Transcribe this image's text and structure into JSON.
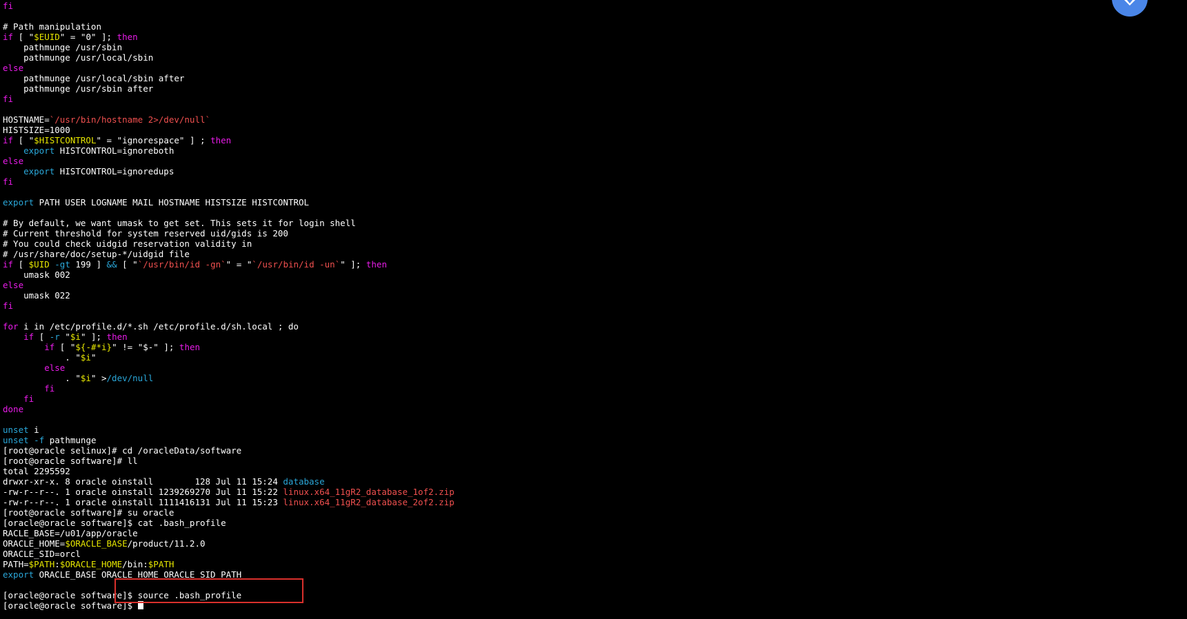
{
  "terminal": {
    "colors": {
      "background": "#000000",
      "foreground": "#ffffff",
      "keyword": "#e81ce8",
      "builtin": "#2aa7d9",
      "string": "#e6e600",
      "command_substitution": "#f0504f",
      "directory": "#2aa7d9",
      "archive": "#f0504f",
      "highlight_box": "#d9302c",
      "widget": "#4a86e8"
    },
    "cursor": "block",
    "lines": [
      [
        {
          "t": "fi",
          "c": "keyword"
        }
      ],
      [],
      [
        {
          "t": "# Path manipulation"
        }
      ],
      [
        {
          "t": "if",
          "c": "keyword"
        },
        {
          "t": " [ \""
        },
        {
          "t": "$EUID",
          "c": "string"
        },
        {
          "t": "\" = \"0\" ]; "
        },
        {
          "t": "then",
          "c": "keyword"
        }
      ],
      [
        {
          "t": "    pathmunge /usr/sbin"
        }
      ],
      [
        {
          "t": "    pathmunge /usr/local/sbin"
        }
      ],
      [
        {
          "t": "else",
          "c": "keyword"
        }
      ],
      [
        {
          "t": "    pathmunge /usr/local/sbin after"
        }
      ],
      [
        {
          "t": "    pathmunge /usr/sbin after"
        }
      ],
      [
        {
          "t": "fi",
          "c": "keyword"
        }
      ],
      [],
      [
        {
          "t": "HOSTNAME="
        },
        {
          "t": "`/usr/bin/hostname 2>/dev/null`",
          "c": "command_substitution"
        }
      ],
      [
        {
          "t": "HISTSIZE=1000"
        }
      ],
      [
        {
          "t": "if",
          "c": "keyword"
        },
        {
          "t": " [ \""
        },
        {
          "t": "$HISTCONTROL",
          "c": "string"
        },
        {
          "t": "\" = \"ignorespace\" ] ; "
        },
        {
          "t": "then",
          "c": "keyword"
        }
      ],
      [
        {
          "t": "    "
        },
        {
          "t": "export",
          "c": "builtin"
        },
        {
          "t": " HISTCONTROL=ignoreboth"
        }
      ],
      [
        {
          "t": "else",
          "c": "keyword"
        }
      ],
      [
        {
          "t": "    "
        },
        {
          "t": "export",
          "c": "builtin"
        },
        {
          "t": " HISTCONTROL=ignoredups"
        }
      ],
      [
        {
          "t": "fi",
          "c": "keyword"
        }
      ],
      [],
      [
        {
          "t": "export",
          "c": "builtin"
        },
        {
          "t": " PATH USER LOGNAME MAIL HOSTNAME HISTSIZE HISTCONTROL"
        }
      ],
      [],
      [
        {
          "t": "# By default, we want umask to get set. This sets it for login shell"
        }
      ],
      [
        {
          "t": "# Current threshold for system reserved uid/gids is 200"
        }
      ],
      [
        {
          "t": "# You could check uidgid reservation validity in"
        }
      ],
      [
        {
          "t": "# /usr/share/doc/setup-*/uidgid file"
        }
      ],
      [
        {
          "t": "if",
          "c": "keyword"
        },
        {
          "t": " [ "
        },
        {
          "t": "$UID",
          "c": "string"
        },
        {
          "t": " "
        },
        {
          "t": "-gt",
          "c": "builtin"
        },
        {
          "t": " 199 ] "
        },
        {
          "t": "&&",
          "c": "builtin"
        },
        {
          "t": " [ \""
        },
        {
          "t": "`/usr/bin/id -gn`",
          "c": "command_substitution"
        },
        {
          "t": "\" = \""
        },
        {
          "t": "`/usr/bin/id -un`",
          "c": "command_substitution"
        },
        {
          "t": "\" ]; "
        },
        {
          "t": "then",
          "c": "keyword"
        }
      ],
      [
        {
          "t": "    umask 002"
        }
      ],
      [
        {
          "t": "else",
          "c": "keyword"
        }
      ],
      [
        {
          "t": "    umask 022"
        }
      ],
      [
        {
          "t": "fi",
          "c": "keyword"
        }
      ],
      [],
      [
        {
          "t": "for",
          "c": "keyword"
        },
        {
          "t": " i in /etc/profile.d/*.sh /etc/profile.d/sh.local ; do"
        }
      ],
      [
        {
          "t": "    "
        },
        {
          "t": "if",
          "c": "keyword"
        },
        {
          "t": " [ "
        },
        {
          "t": "-r",
          "c": "builtin"
        },
        {
          "t": " \""
        },
        {
          "t": "$i",
          "c": "string"
        },
        {
          "t": "\" ]; "
        },
        {
          "t": "then",
          "c": "keyword"
        }
      ],
      [
        {
          "t": "        "
        },
        {
          "t": "if",
          "c": "keyword"
        },
        {
          "t": " [ \""
        },
        {
          "t": "${-#*i}",
          "c": "string"
        },
        {
          "t": "\" != \"$-\" ]; "
        },
        {
          "t": "then",
          "c": "keyword"
        }
      ],
      [
        {
          "t": "            . \""
        },
        {
          "t": "$i",
          "c": "string"
        },
        {
          "t": "\""
        }
      ],
      [
        {
          "t": "        "
        },
        {
          "t": "else",
          "c": "keyword"
        }
      ],
      [
        {
          "t": "            . \""
        },
        {
          "t": "$i",
          "c": "string"
        },
        {
          "t": "\" >"
        },
        {
          "t": "/dev/null",
          "c": "builtin"
        }
      ],
      [
        {
          "t": "        "
        },
        {
          "t": "fi",
          "c": "keyword"
        }
      ],
      [
        {
          "t": "    "
        },
        {
          "t": "fi",
          "c": "keyword"
        }
      ],
      [
        {
          "t": "done",
          "c": "keyword"
        }
      ],
      [],
      [
        {
          "t": "unset",
          "c": "builtin"
        },
        {
          "t": " i"
        }
      ],
      [
        {
          "t": "unset",
          "c": "builtin"
        },
        {
          "t": " "
        },
        {
          "t": "-f",
          "c": "builtin"
        },
        {
          "t": " pathmunge"
        }
      ],
      [
        {
          "t": "[root@oracle selinux]# cd /oracleData/software"
        }
      ],
      [
        {
          "t": "[root@oracle software]# ll"
        }
      ],
      [
        {
          "t": "total 2295592"
        }
      ],
      [
        {
          "t": "drwxr-xr-x. 8 oracle oinstall        128 Jul 11 15:24 "
        },
        {
          "t": "database",
          "c": "directory"
        }
      ],
      [
        {
          "t": "-rw-r--r--. 1 oracle oinstall 1239269270 Jul 11 15:22 "
        },
        {
          "t": "linux.x64_11gR2_database_1of2.zip",
          "c": "archive"
        }
      ],
      [
        {
          "t": "-rw-r--r--. 1 oracle oinstall 1111416131 Jul 11 15:23 "
        },
        {
          "t": "linux.x64_11gR2_database_2of2.zip",
          "c": "archive"
        }
      ],
      [
        {
          "t": "[root@oracle software]# su oracle"
        }
      ],
      [
        {
          "t": "[oracle@oracle software]$ cat .bash_profile"
        }
      ],
      [
        {
          "t": "RACLE_BASE=/u01/app/oracle"
        }
      ],
      [
        {
          "t": "ORACLE_HOME="
        },
        {
          "t": "$ORACLE_BASE",
          "c": "string"
        },
        {
          "t": "/product/11.2.0"
        }
      ],
      [
        {
          "t": "ORACLE_SID=orcl"
        }
      ],
      [
        {
          "t": "PATH="
        },
        {
          "t": "$PATH",
          "c": "string"
        },
        {
          "t": ":"
        },
        {
          "t": "$ORACLE_HOME",
          "c": "string"
        },
        {
          "t": "/bin:"
        },
        {
          "t": "$PATH",
          "c": "string"
        }
      ],
      [
        {
          "t": "export",
          "c": "builtin"
        },
        {
          "t": " ORACLE_BASE ORACLE_HOME ORACLE_SID PATH"
        }
      ],
      [],
      [
        {
          "t": "[oracle@oracle software]$ source .bash_profile"
        }
      ],
      [
        {
          "t": "[oracle@oracle software]$ "
        },
        {
          "t": "__CURSOR__",
          "c": "cursor"
        }
      ]
    ]
  }
}
